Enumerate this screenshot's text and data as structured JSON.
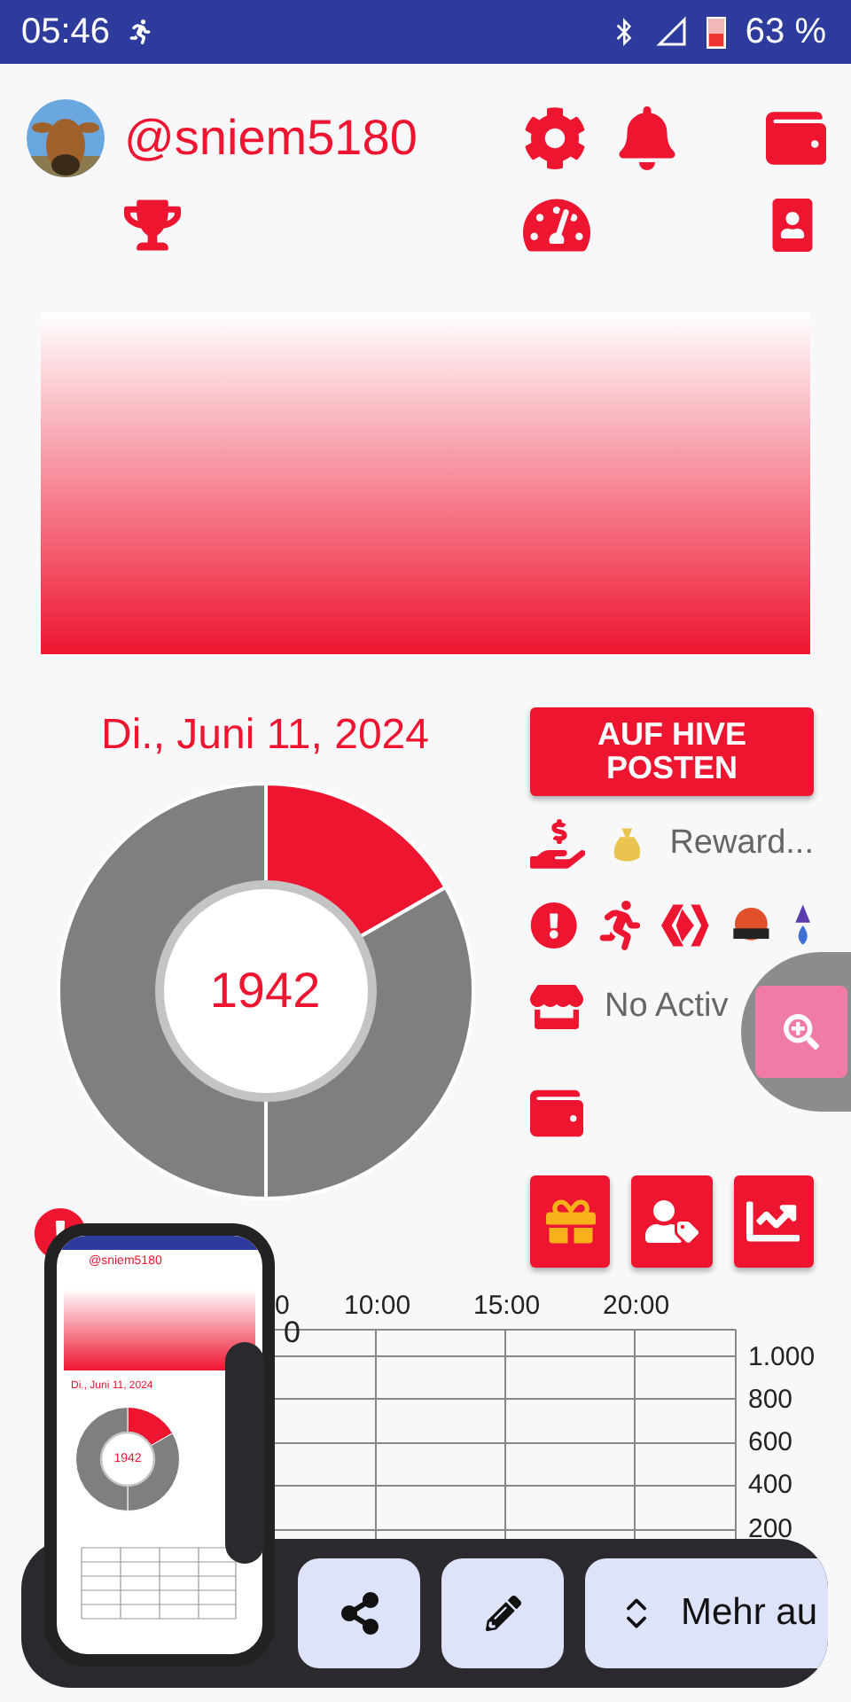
{
  "status_bar": {
    "time": "05:46",
    "battery": "63 %"
  },
  "profile": {
    "username": "@sniem5180"
  },
  "date": "Di., Juni 11, 2024",
  "post_button": "AUF HIVE POSTEN",
  "donut": {
    "value": "1942"
  },
  "reward_text": "Reward...",
  "gadget_text": "No Activ",
  "chart": {
    "x_labels": [
      "0",
      "10:00",
      "15:00",
      "20:00"
    ],
    "corner_label": "0",
    "y_labels": [
      "1.000",
      "800",
      "600",
      "400",
      "200"
    ]
  },
  "toolbar": {
    "buttons": [
      {
        "kind": "share"
      },
      {
        "kind": "edit"
      },
      {
        "kind": "more",
        "label": "Mehr au"
      }
    ]
  },
  "thumbnail": {
    "username": "@sniem5180",
    "date": "Di., Juni 11, 2024",
    "value": "1942"
  }
}
